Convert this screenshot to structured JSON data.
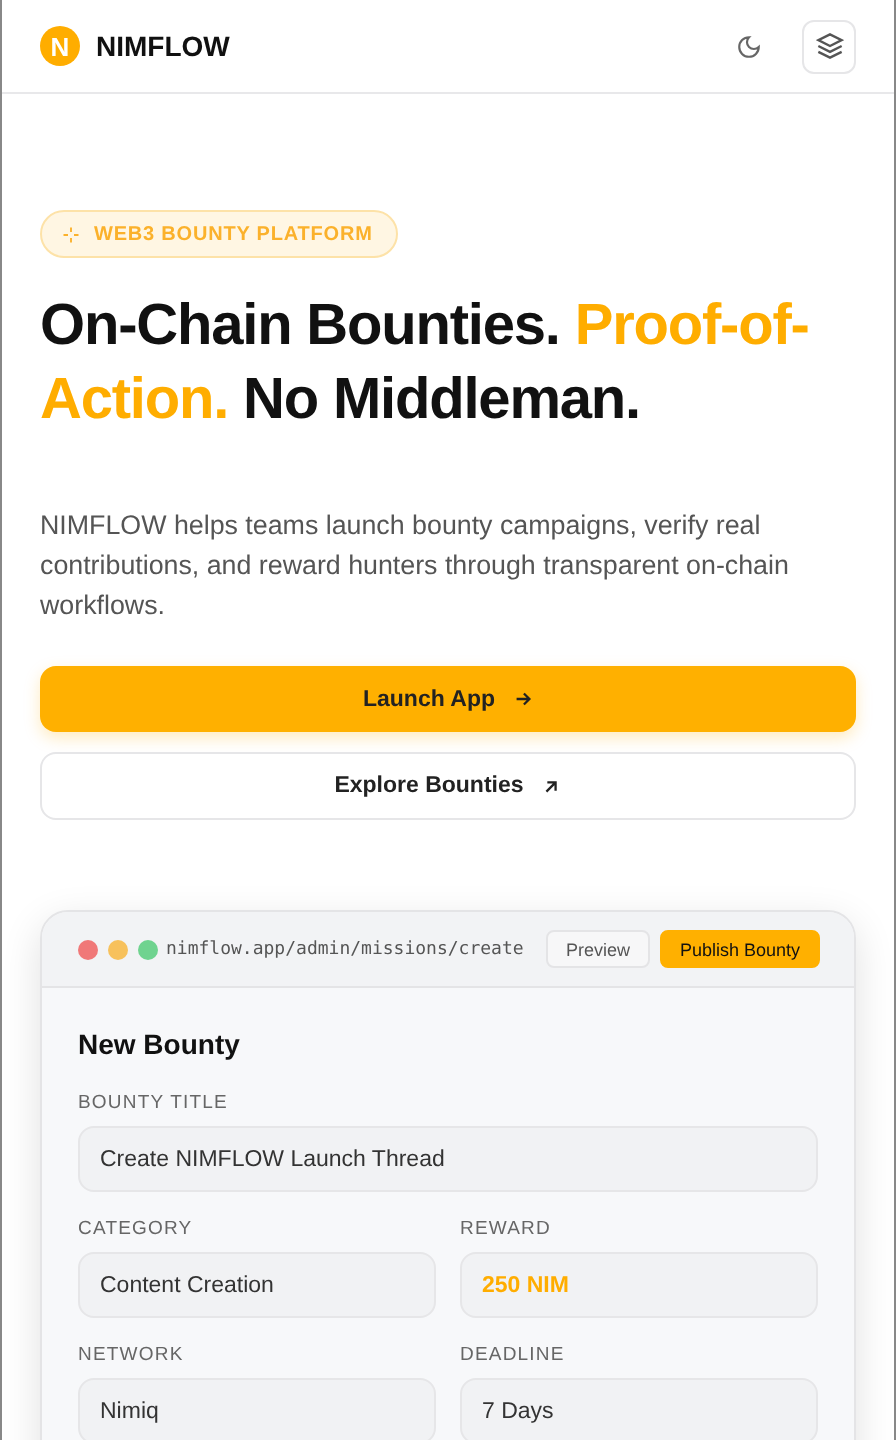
{
  "header": {
    "logo_letter": "N",
    "brand": "NIMFLOW"
  },
  "hero": {
    "badge": "WEB3 BOUNTY PLATFORM",
    "headline": [
      {
        "text": "On-Chain Bounties.",
        "accent": false
      },
      {
        "text": "Proof-of-Action.",
        "accent": true
      },
      {
        "text": "No Middleman.",
        "accent": false
      }
    ],
    "description": "NIMFLOW helps teams launch bounty campaigns, verify real contributions, and reward hunters through transparent on-chain workflows.",
    "buttons": [
      {
        "label": "Launch App",
        "kind": "primary"
      },
      {
        "label": "Explore Bounties",
        "kind": "secondary"
      }
    ]
  },
  "preview": {
    "url": "nimflow.app/admin/missions/create",
    "actions": [
      {
        "label": "Preview",
        "kind": "secondary"
      },
      {
        "label": "Publish Bounty",
        "kind": "primary"
      }
    ],
    "form_title": "New Bounty",
    "fields": [
      {
        "label": "BOUNTY TITLE",
        "value": "Create NIMFLOW Launch Thread",
        "wide": true,
        "highlight": false
      },
      {
        "label": "CATEGORY",
        "value": "Content Creation",
        "wide": false,
        "highlight": false
      },
      {
        "label": "REWARD",
        "value": "250 NIM",
        "wide": false,
        "highlight": true
      },
      {
        "label": "NETWORK",
        "value": "Nimiq",
        "wide": false,
        "highlight": false
      },
      {
        "label": "DEADLINE",
        "value": "7 Days",
        "wide": false,
        "highlight": false
      }
    ]
  }
}
